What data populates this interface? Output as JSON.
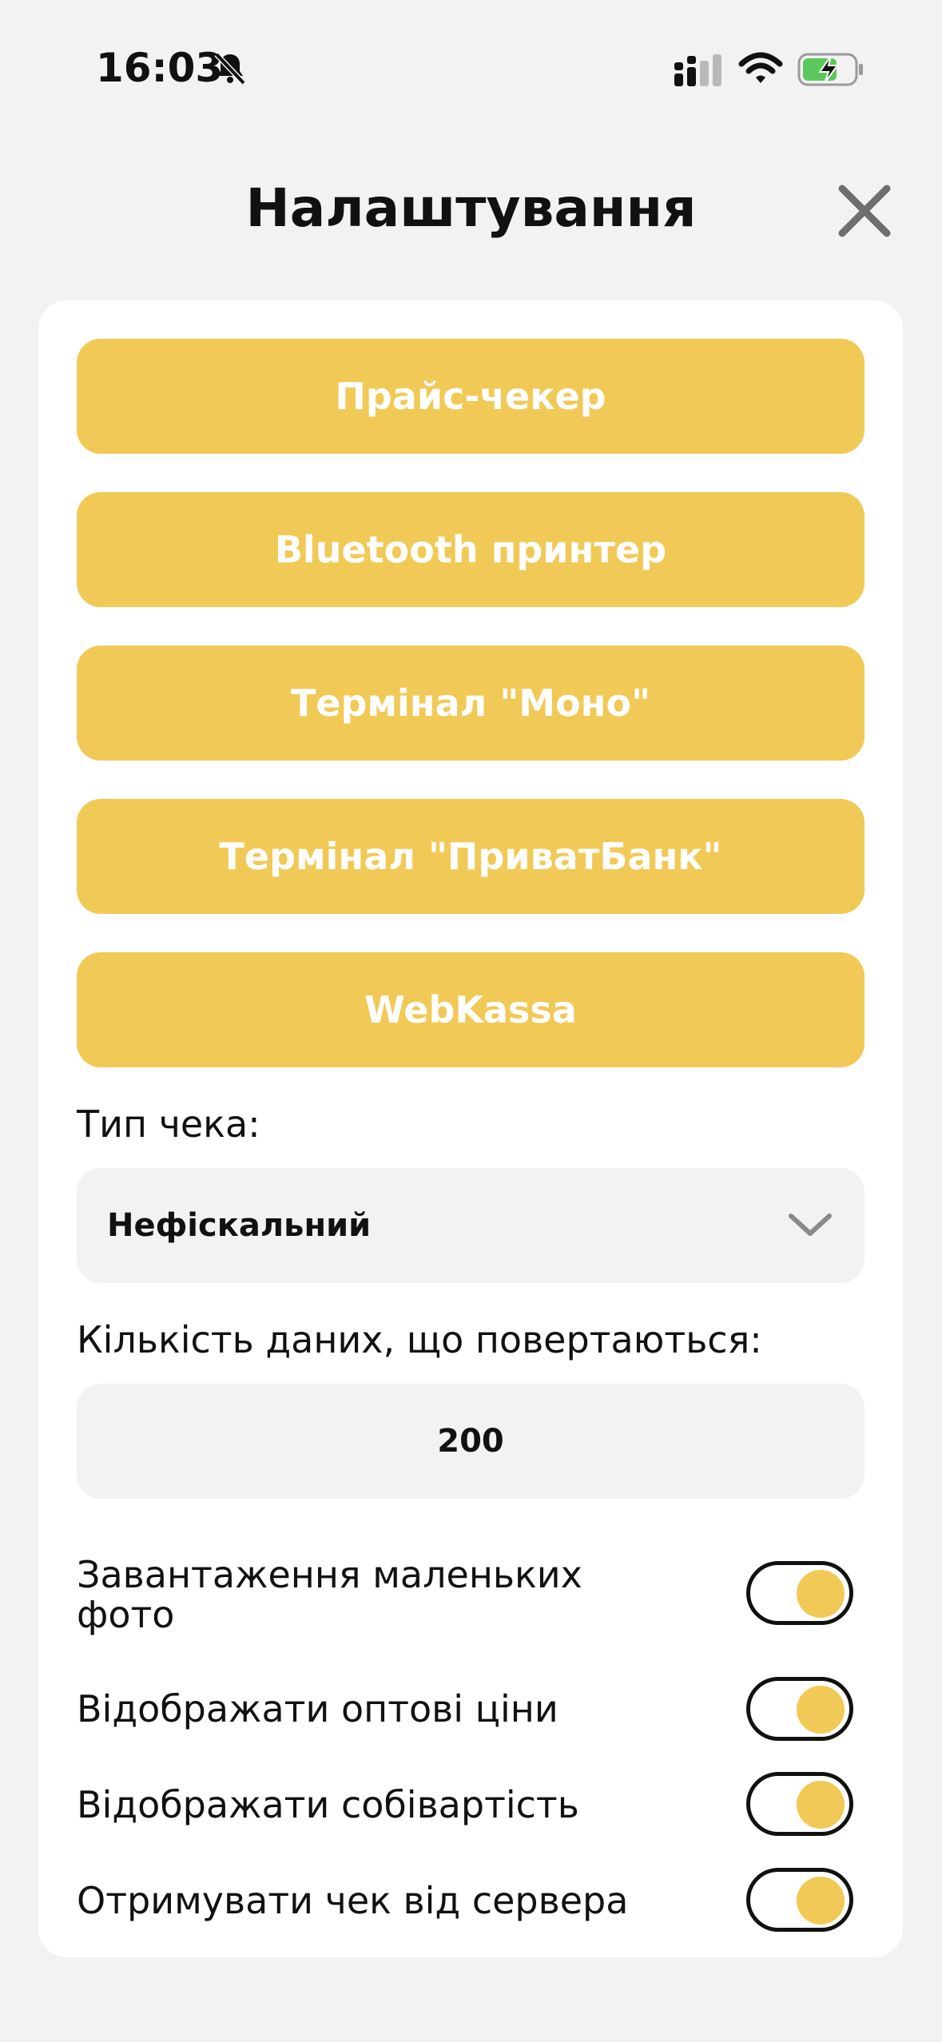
{
  "status_bar": {
    "time": "16:03"
  },
  "header": {
    "title": "Налаштування"
  },
  "buttons": [
    {
      "label": "Прайс-чекер"
    },
    {
      "label": "Bluetooth принтер"
    },
    {
      "label": "Термінал \"Моно\""
    },
    {
      "label": "Термінал  \"ПриватБанк\""
    },
    {
      "label": "WebKassa"
    }
  ],
  "receipt_type": {
    "label": "Тип чека:",
    "selected": "Нефіскальний"
  },
  "data_count": {
    "label": "Кількість даних, що повертаються:",
    "value": "200"
  },
  "toggles": [
    {
      "label": "Завантаження маленьких фото",
      "on": true
    },
    {
      "label": "Відображати оптові ціни",
      "on": true
    },
    {
      "label": "Відображати собівартість",
      "on": true
    },
    {
      "label": "Отримувати чек від сервера",
      "on": true
    }
  ],
  "colors": {
    "accent": "#f1c956",
    "background": "#f2f2f3",
    "field": "#f2f2f4",
    "battery": "#5ac85a"
  },
  "icons": [
    "bell-slash-icon",
    "cellular-signal-icon",
    "wifi-icon",
    "battery-charging-icon",
    "close-icon",
    "chevron-down-icon"
  ]
}
